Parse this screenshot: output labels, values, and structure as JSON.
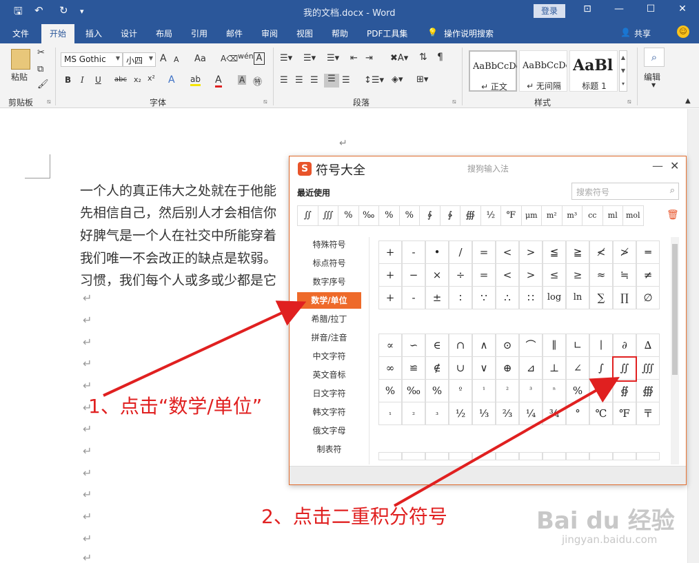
{
  "titlebar": {
    "doc_title": "我的文档.docx - Word",
    "login": "登录",
    "save_icon": "save-icon",
    "undo_icon": "undo-icon",
    "redo_icon": "redo-icon"
  },
  "menu": {
    "tabs": [
      "文件",
      "开始",
      "插入",
      "设计",
      "布局",
      "引用",
      "邮件",
      "审阅",
      "视图",
      "帮助",
      "PDF工具集"
    ],
    "tell_me": "操作说明搜索",
    "share": "共享"
  },
  "ribbon": {
    "paste": "粘贴",
    "clipboard_label": "剪贴板",
    "font_name": "MS Gothic",
    "font_size": "小四",
    "font_label": "字体",
    "paragraph_label": "段落",
    "styles_label": "样式",
    "styles": [
      {
        "preview": "AaBbCcDd",
        "name": "↵ 正文"
      },
      {
        "preview": "AaBbCcDd",
        "name": "↵ 无间隔"
      },
      {
        "preview": "AaBl",
        "name": "标题 1"
      }
    ],
    "edit": "编辑",
    "bold": "B",
    "italic": "I",
    "underline": "U",
    "strike": "abc",
    "wen": "wén",
    "font_grow": "A",
    "font_shrink": "A",
    "case": "Aa",
    "char_border": "A"
  },
  "document": {
    "para_top": "↵",
    "lines": [
      "一个人的真正伟大之处就在于他能",
      "先相信自己，然后别人才会相信你",
      "好脾气是一个人在社交中所能穿着",
      "我们唯一不会改正的缺点是软弱。",
      "习惯，我们每个人或多或少都是它"
    ],
    "mark": "↵"
  },
  "dialog": {
    "title": "符号大全",
    "subtitle": "搜狗输入法",
    "recent_label": "最近使用",
    "search_placeholder": "搜索符号",
    "recent": [
      "∬",
      "∭",
      "%",
      "‰",
      "%",
      "%",
      "∲",
      "∳",
      "∰",
      "½",
      "℉",
      "μm",
      "m²",
      "m³",
      "cc",
      "ml",
      "mol"
    ],
    "categories": [
      "特殊符号",
      "标点符号",
      "数字序号",
      "数学/单位",
      "希腊/拉丁",
      "拼音/注音",
      "中文字符",
      "英文音标",
      "日文字符",
      "韩文字符",
      "俄文字母",
      "制表符"
    ],
    "active_category": "数学/单位",
    "grid1": [
      [
        "+",
        "-",
        "•",
        "/",
        "=",
        "<",
        ">",
        "≦",
        "≧",
        "≮",
        "≯",
        "═"
      ],
      [
        "+",
        "−",
        "×",
        "÷",
        "=",
        "<",
        ">",
        "≤",
        "≥",
        "≈",
        "≒",
        "≠"
      ],
      [
        "+",
        "-",
        "±",
        "∶",
        "∵",
        "∴",
        "∷",
        "log",
        "ln",
        "∑",
        "∏",
        "∅"
      ]
    ],
    "grid2": [
      [
        "∝",
        "∽",
        "∈",
        "∩",
        "∧",
        "⊙",
        "⌒",
        "∥",
        "∟",
        "∣",
        "∂",
        "∆"
      ],
      [
        "∞",
        "≌",
        "∉",
        "∪",
        "∨",
        "⊕",
        "⊿",
        "⊥",
        "∠",
        "∫",
        "∬",
        "∭"
      ],
      [
        "%",
        "‰",
        "%",
        "º",
        "¹",
        "²",
        "³",
        "ⁿ",
        "%",
        "∮",
        "∯",
        "∰"
      ],
      [
        "₁",
        "₂",
        "₃",
        "½",
        "⅓",
        "⅔",
        "¼",
        "¾",
        "°",
        "℃",
        "℉",
        "〒"
      ]
    ]
  },
  "annotations": {
    "step1": "1、点击“数学/单位”",
    "step2": "2、点击二重积分符号"
  },
  "watermark": {
    "brand": "Bai du 经验",
    "url": "jingyan.baidu.com"
  },
  "colors": {
    "word_blue": "#2b579a",
    "accent_orange": "#ee6a2a",
    "annotation_red": "#e02020"
  }
}
